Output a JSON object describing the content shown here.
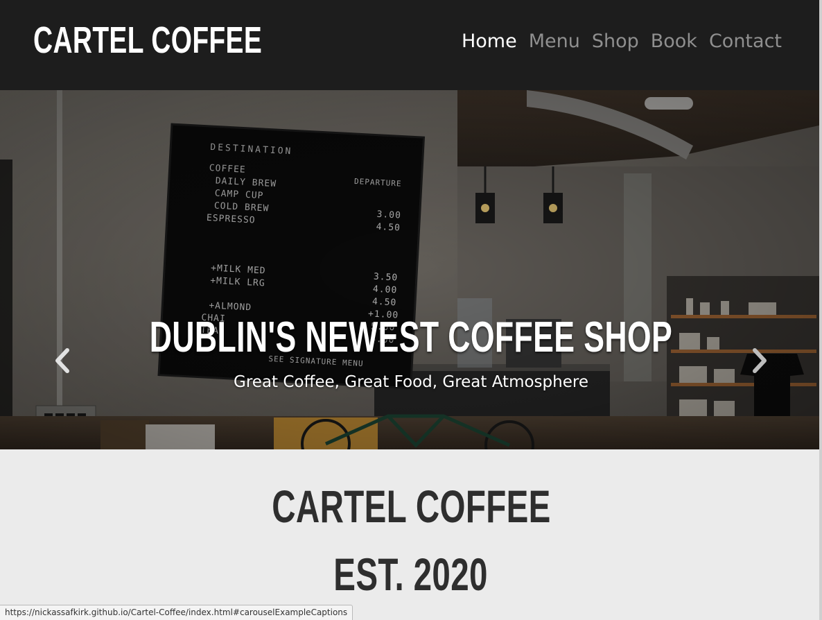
{
  "header": {
    "brand": "CARTEL COFFEE",
    "nav": [
      {
        "label": "Home",
        "active": true
      },
      {
        "label": "Menu",
        "active": false
      },
      {
        "label": "Shop",
        "active": false
      },
      {
        "label": "Book",
        "active": false
      },
      {
        "label": "Contact",
        "active": false
      }
    ]
  },
  "carousel": {
    "title": "DUBLIN'S NEWEST COFFEE SHOP",
    "subtitle": "Great Coffee, Great Food, Great Atmosphere",
    "prev_icon": "chevron-left-icon",
    "next_icon": "chevron-right-icon",
    "board": {
      "heading": "DESTINATION",
      "departure": "DEPARTURE",
      "items": [
        "COFFEE",
        "DAILY BREW",
        "CAMP CUP",
        "COLD BREW",
        "ESPRESSO",
        "+MILK MED",
        "+MILK LRG",
        "+ALMOND",
        "CHAI",
        "TEA"
      ],
      "prices": [
        "3.00",
        "4.50",
        "4.00",
        "3.50",
        "4.00",
        "4.50",
        "+1.00",
        "5.00",
        "4.00"
      ],
      "footer": "SEE SIGNATURE MENU"
    }
  },
  "intro": {
    "line1": "CARTEL COFFEE",
    "line2": "EST. 2020"
  },
  "status_bar": {
    "url": "https://nickassafkirk.github.io/Cartel-Coffee/index.html#carouselExampleCaptions"
  },
  "colors": {
    "navbar_bg": "#1d1d1d",
    "nav_active": "#ffffff",
    "nav_inactive": "#8f8f8f",
    "intro_bg": "#ebebeb",
    "intro_text": "#2e2e2e"
  }
}
